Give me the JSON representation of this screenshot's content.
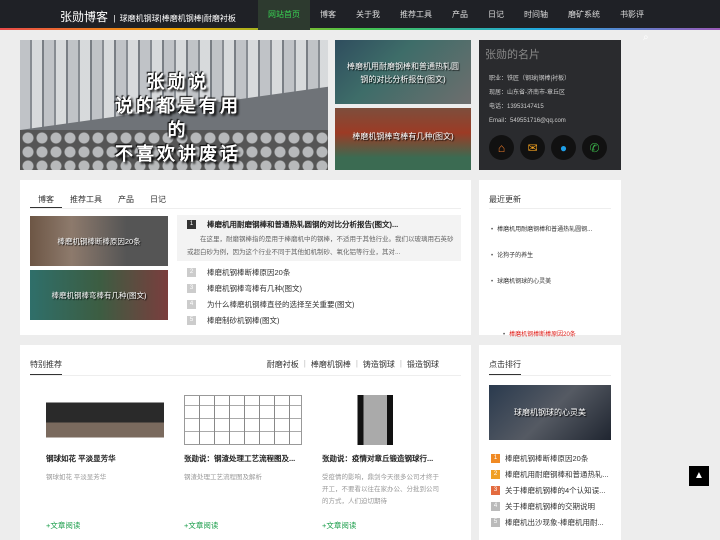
{
  "header": {
    "logo": "张勋博客",
    "tagline": "球磨机钢球|棒磨机钢棒|耐磨衬板",
    "nav": [
      "网站首页",
      "博客",
      "关于我",
      "推荐工具",
      "产品",
      "日记",
      "时间轴",
      "磨矿系统",
      "书影评"
    ]
  },
  "hero": {
    "caption_line1": "张勋说",
    "caption_line2": "说的都是有用的",
    "caption_line3": "不喜欢讲废话",
    "thumb1": "棒磨机用耐磨钢棒和普通热轧圆钢的对比分析报告(图文)",
    "thumb2": "棒磨机钢棒弯棒有几种(图文)"
  },
  "card": {
    "title": "张勋的名片",
    "job": "职业：铁匠（钢球|钢棒|衬板）",
    "region": "现居：山东省-济南市-章丘区",
    "phone": "电话：13953147415",
    "email": "Email：549551716@qq.com",
    "icons": [
      "home-icon",
      "mail-icon",
      "qq-icon",
      "wechat-icon"
    ]
  },
  "tabs_panel": {
    "tabs": [
      "博客",
      "推荐工具",
      "产品",
      "日记"
    ],
    "img1": "棒磨机钢棒断棒原因20条",
    "img2": "棒磨机钢棒弯棒有几种(图文)",
    "featured_num": "1",
    "featured_title": "棒磨机用耐磨钢棒和普通热轧圆钢的对比分析报告(图文)...",
    "featured_desc": "在这里，耐磨钢棒指的是用于棒磨机中的钢棒，不适用于其他行业。我们以玻璃用石英砂或超白砂为例，因为这个行业不同于其他如机制砂、氧化铝等行业，其对...",
    "list": [
      {
        "num": "2",
        "title": "棒磨机钢棒断棒原因20条"
      },
      {
        "num": "3",
        "title": "棒磨机钢棒弯棒有几种(图文)"
      },
      {
        "num": "4",
        "title": "为什么棒磨机钢棒直径的选择至关重要(图文)"
      },
      {
        "num": "5",
        "title": "棒磨制砂机钢棒(图文)"
      }
    ]
  },
  "recent": {
    "title": "最近更新",
    "items": [
      "棒磨机用耐磨钢棒和普通热轧圆钢...",
      "棒磨机钢棒断棒原因20条",
      "论狗子的养生",
      "球磨机钢球的心灵美"
    ]
  },
  "special": {
    "title": "特别推荐",
    "cats": [
      "耐磨衬板",
      "棒磨机钢棒",
      "铸造钢球",
      "锻造钢球"
    ],
    "items": [
      {
        "title": "钢球如花 平淡显芳华",
        "desc": "钢球如花 平淡显芳华",
        "more": "+文章阅读"
      },
      {
        "title": "张勋说：钢渣处理工艺流程图及...",
        "desc": "钢渣处理工艺流程图及解析",
        "more": "+文章阅读"
      },
      {
        "title": "张勋说：疫情对章丘锻造钢球行...",
        "desc": "受疫情的影响，鼎剑今天很多公司才终于开工，不要看以往在家办公、分批到公司的方式，人们迫切期待",
        "more": "+文章阅读"
      }
    ]
  },
  "hot": {
    "title": "点击排行",
    "pic_label": "球磨机钢球的心灵美",
    "items": [
      {
        "num": "1",
        "title": "棒磨机钢棒断棒原因20条"
      },
      {
        "num": "2",
        "title": "棒磨机用耐磨钢棒和普通热轧..."
      },
      {
        "num": "3",
        "title": "关于棒磨机钢棒的4个认知误..."
      },
      {
        "num": "4",
        "title": "关于棒磨机钢棒的交期说明"
      },
      {
        "num": "5",
        "title": "棒磨机出沙现象-棒磨机用耐..."
      }
    ]
  }
}
